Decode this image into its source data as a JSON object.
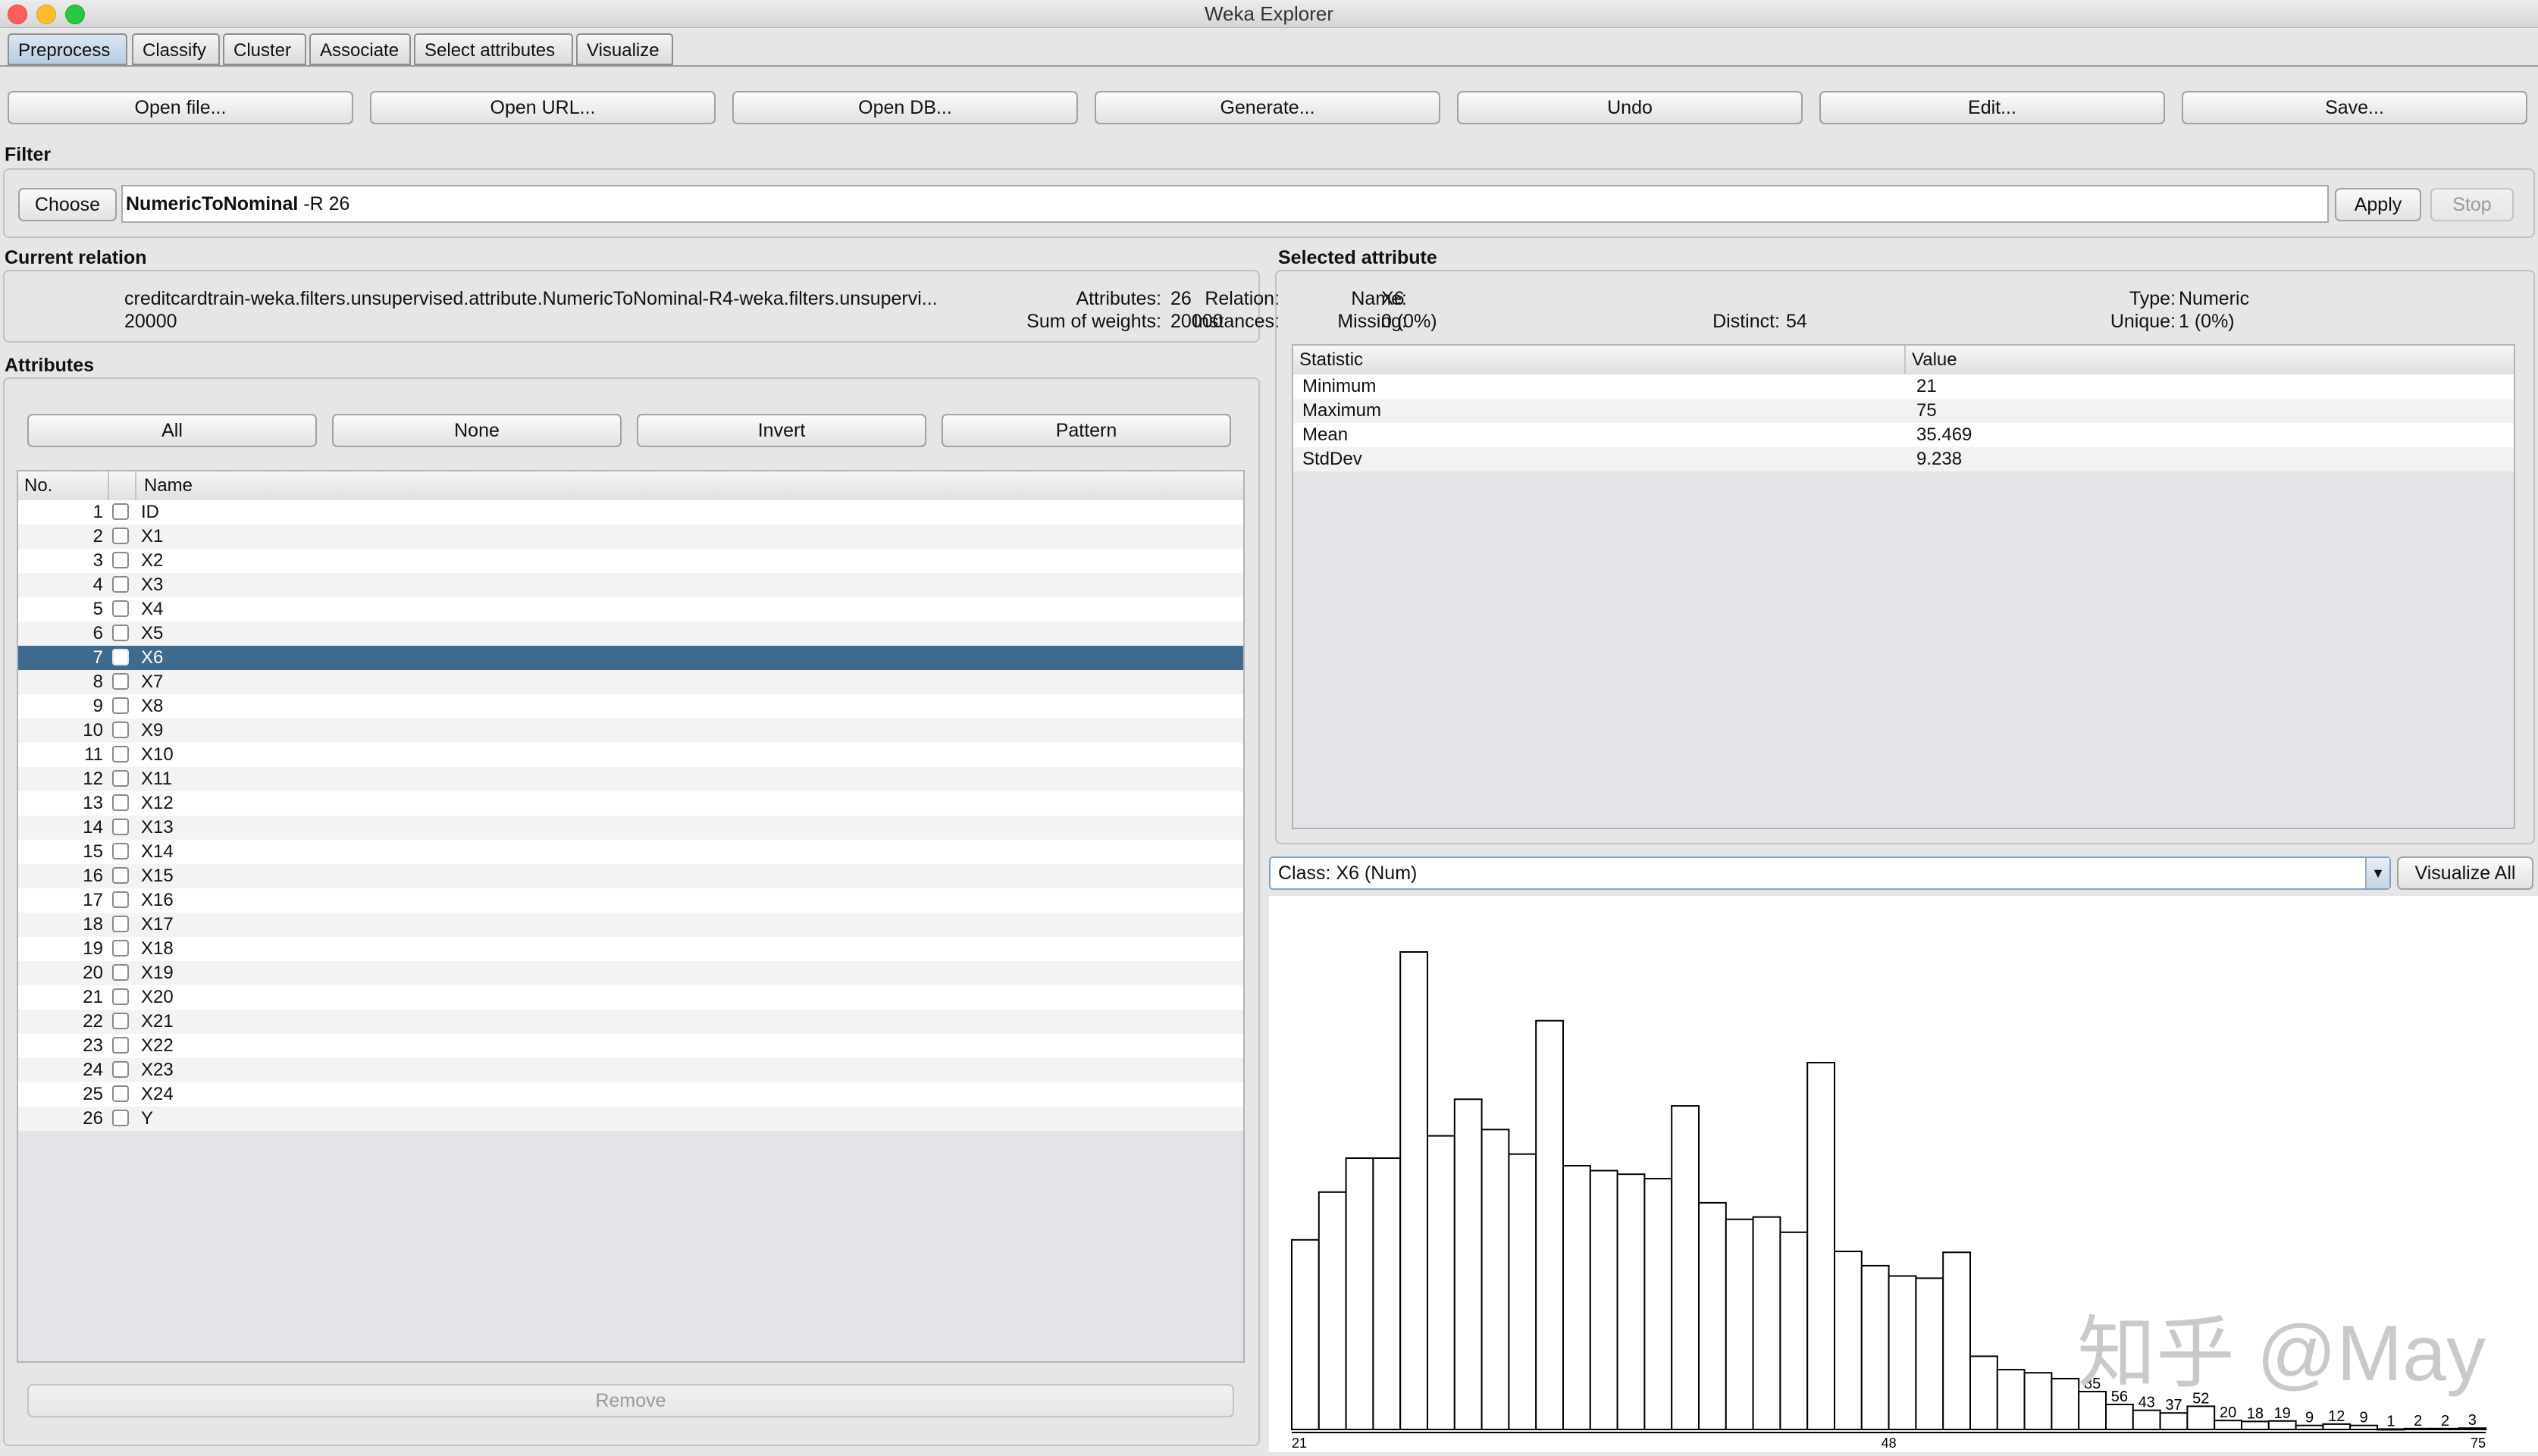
{
  "window": {
    "title": "Weka Explorer"
  },
  "tabs": [
    "Preprocess",
    "Classify",
    "Cluster",
    "Associate",
    "Select attributes",
    "Visualize"
  ],
  "toolbar": {
    "open_file": "Open file...",
    "open_url": "Open URL...",
    "open_db": "Open DB...",
    "generate": "Generate...",
    "undo": "Undo",
    "edit": "Edit...",
    "save": "Save..."
  },
  "filter": {
    "title": "Filter",
    "choose": "Choose",
    "name": "NumericToNominal",
    "options": "-R 26",
    "apply": "Apply",
    "stop": "Stop"
  },
  "relation": {
    "title": "Current relation",
    "relation_label": "Relation:",
    "relation_value": "creditcardtrain-weka.filters.unsupervised.attribute.NumericToNominal-R4-weka.filters.unsupervi...",
    "instances_label": "Instances:",
    "instances_value": "20000",
    "attributes_label": "Attributes:",
    "attributes_value": "26",
    "weights_label": "Sum of weights:",
    "weights_value": "20000"
  },
  "attributes": {
    "title": "Attributes",
    "buttons": {
      "all": "All",
      "none": "None",
      "invert": "Invert",
      "pattern": "Pattern"
    },
    "col_no": "No.",
    "col_name": "Name",
    "rows": [
      {
        "no": "1",
        "name": "ID"
      },
      {
        "no": "2",
        "name": "X1"
      },
      {
        "no": "3",
        "name": "X2"
      },
      {
        "no": "4",
        "name": "X3"
      },
      {
        "no": "5",
        "name": "X4"
      },
      {
        "no": "6",
        "name": "X5"
      },
      {
        "no": "7",
        "name": "X6",
        "selected": true
      },
      {
        "no": "8",
        "name": "X7"
      },
      {
        "no": "9",
        "name": "X8"
      },
      {
        "no": "10",
        "name": "X9"
      },
      {
        "no": "11",
        "name": "X10"
      },
      {
        "no": "12",
        "name": "X11"
      },
      {
        "no": "13",
        "name": "X12"
      },
      {
        "no": "14",
        "name": "X13"
      },
      {
        "no": "15",
        "name": "X14"
      },
      {
        "no": "16",
        "name": "X15"
      },
      {
        "no": "17",
        "name": "X16"
      },
      {
        "no": "18",
        "name": "X17"
      },
      {
        "no": "19",
        "name": "X18"
      },
      {
        "no": "20",
        "name": "X19"
      },
      {
        "no": "21",
        "name": "X20"
      },
      {
        "no": "22",
        "name": "X21"
      },
      {
        "no": "23",
        "name": "X22"
      },
      {
        "no": "24",
        "name": "X23"
      },
      {
        "no": "25",
        "name": "X24"
      },
      {
        "no": "26",
        "name": "Y"
      }
    ],
    "remove": "Remove"
  },
  "selected": {
    "title": "Selected attribute",
    "name_label": "Name:",
    "name_value": "X6",
    "missing_label": "Missing:",
    "missing_value": "0 (0%)",
    "distinct_label": "Distinct:",
    "distinct_value": "54",
    "type_label": "Type:",
    "type_value": "Numeric",
    "unique_label": "Unique:",
    "unique_value": "1 (0%)",
    "col_statistic": "Statistic",
    "col_value": "Value",
    "stats": [
      {
        "name": "Minimum",
        "value": "21"
      },
      {
        "name": "Maximum",
        "value": "75"
      },
      {
        "name": "Mean",
        "value": "35.469"
      },
      {
        "name": "StdDev",
        "value": "9.238"
      }
    ]
  },
  "class_select": {
    "value": "Class: X6 (Num)",
    "visualize_all": "Visualize All"
  },
  "histogram": {
    "bins": [
      425,
      532,
      608,
      608,
      1070,
      658,
      740,
      672,
      617,
      916,
      591,
      580,
      572,
      562,
      725,
      508,
      471,
      476,
      442,
      822,
      399,
      367,
      344,
      339,
      397,
      164,
      134,
      127,
      114,
      85,
      56,
      43,
      37,
      52,
      20,
      18,
      19,
      9,
      12,
      9,
      1,
      2,
      2,
      3
    ],
    "bar_labels": [
      "85",
      "56",
      "43",
      "37",
      "52",
      "20",
      "18",
      "19",
      "9",
      "12",
      "9",
      "1",
      "2",
      "2",
      "3"
    ],
    "axis_labels": [
      "21",
      "48",
      "75"
    ]
  },
  "watermark": "知乎 @May",
  "colors": {
    "selection": "#3e6a8e",
    "accent": "#7da2cf"
  }
}
